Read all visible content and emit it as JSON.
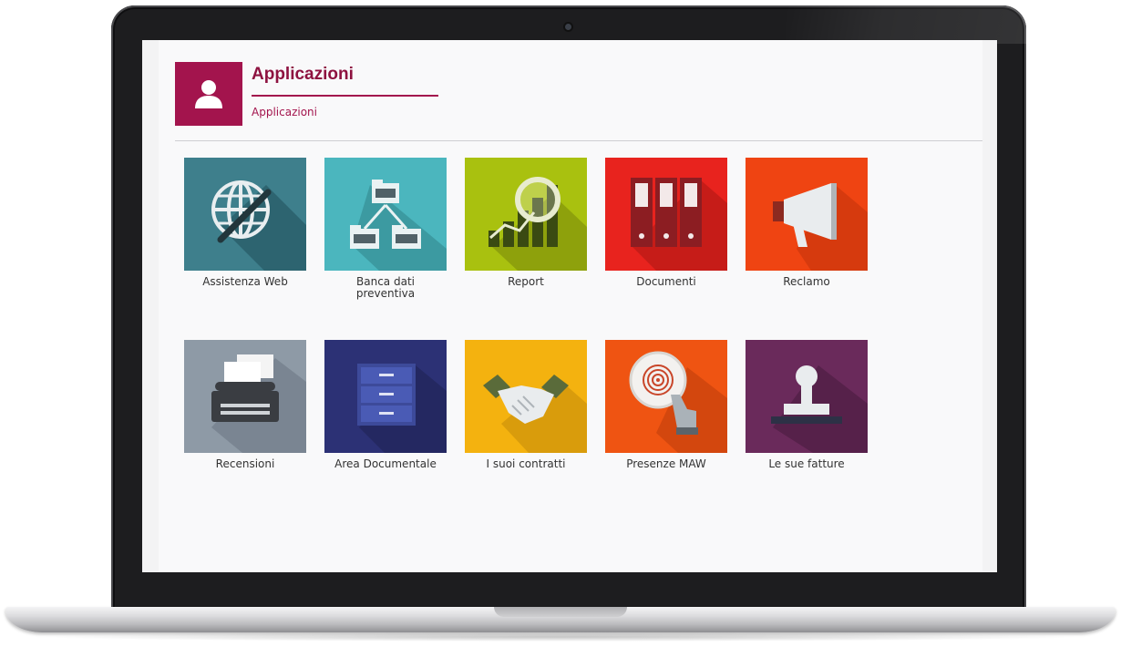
{
  "header": {
    "title": "Applicazioni",
    "breadcrumb": "Applicazioni",
    "icon": "user-icon",
    "accent_color": "#a3144d"
  },
  "tiles": [
    {
      "label": "Assistenza Web",
      "icon": "globe-icon",
      "color": "#3e7f8c"
    },
    {
      "label": "Banca dati preventiva",
      "icon": "folder-tree-icon",
      "color": "#4bb6be"
    },
    {
      "label": "Report",
      "icon": "bar-chart-magnifier-icon",
      "color": "#a9c10f"
    },
    {
      "label": "Documenti",
      "icon": "binders-icon",
      "color": "#e8231e"
    },
    {
      "label": "Reclamo",
      "icon": "megaphone-icon",
      "color": "#ef4412"
    },
    {
      "label": "Recensioni",
      "icon": "typewriter-icon",
      "color": "#8e9aa6"
    },
    {
      "label": "Area Documentale",
      "icon": "filing-cabinet-icon",
      "color": "#2c3175"
    },
    {
      "label": "I suoi contratti",
      "icon": "handshake-icon",
      "color": "#f4b20f"
    },
    {
      "label": "Presenze MAW",
      "icon": "fingerprint-icon",
      "color": "#ef5412"
    },
    {
      "label": "Le sue fatture",
      "icon": "stamp-icon",
      "color": "#6a2a5b"
    }
  ]
}
